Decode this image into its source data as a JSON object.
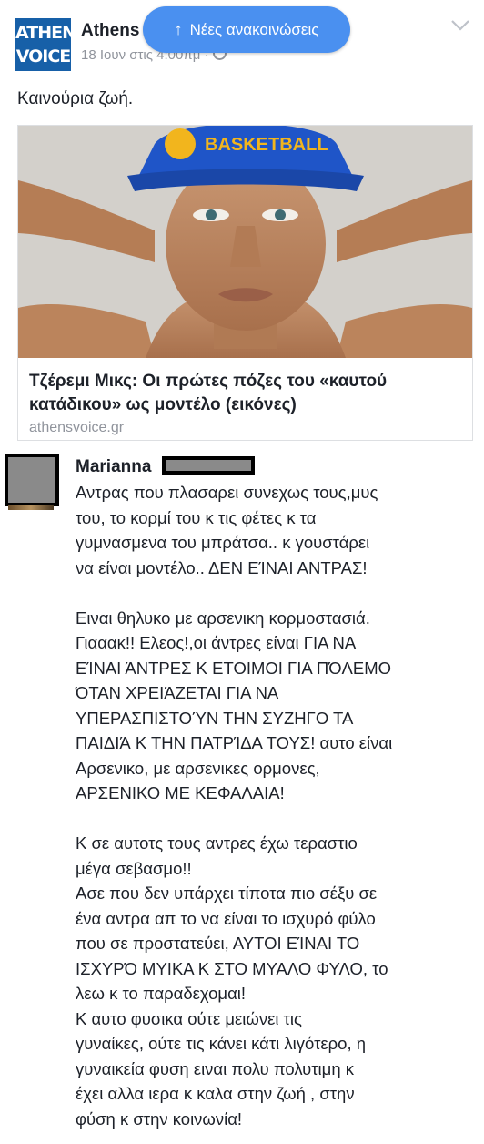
{
  "post": {
    "logo_line1": "ATHENS",
    "logo_line2": "VOICE",
    "page_name": "Athens",
    "meta": "18 Ιουν στις 4:00πμ ·",
    "new_posts_pill": "Νέες ανακοινώσεις",
    "text": "Καινούρια ζωή.",
    "link": {
      "image_cap_text": "BASKETBALL",
      "title_line1": "Τζέρεμι Μικς: Οι πρώτες πόζες του «καυτού",
      "title_line2": "κατάδικου» ως μοντέλο (εικόνες)",
      "domain": "athensvoice.gr"
    }
  },
  "comment": {
    "author": "Marianna",
    "lines": [
      "Αντρας που πλασαρει συνεχως τους,μυς",
      "του, το κορμί του κ τις φέτες κ τα",
      "γυμνασμενα του μπράτσα.. κ γουστάρει",
      "να είναι μοντέλο.. ΔΕΝ ΕΊΝΑΙ ΑΝΤΡΑΣ!",
      "",
      "Ειναι θηλυκο με αρσενικη κορμοστασιά.",
      "Γιααακ!! Ελεος!,οι άντρες είναι ΓΙΑ ΝΑ",
      "ΕΊΝΑΙ ΆΝΤΡΕΣ Κ ΕΤΟΙΜΟΙ ΓΙΑ ΠΌΛΕΜΟ",
      "ΌΤΑΝ ΧΡΕΙΆΖΕΤΑΙ ΓΙΑ ΝΑ",
      "ΥΠΕΡΑΣΠΙΣΤΟΎΝ ΤΗΝ ΣΥΖΗΓΟ ΤΑ",
      "ΠΑΙΔΙΆ Κ ΤΗΝ ΠΑΤΡΊΔΑ ΤΟΥΣ! αυτο είναι",
      "Αρσενικο, με αρσενικες ορμονες,",
      "ΑΡΣΕΝΙΚΟ ΜΕ ΚΕΦΑΛΑΙΑ!",
      "",
      "Κ σε αυτοτς τους αντρες έχω τεραστιο",
      "μέγα σεβασμο!!",
      "Ασε που δεν υπάρχει τίποτα πιο σέξυ σε",
      "ένα αντρα απ το να είναι το ισχυρό φύλο",
      "που σε προστατεύει, ΑΥΤΟΙ ΕΊΝΑΙ ΤΟ",
      "ΙΣΧΥΡΌ ΜΥΙΚΑ Κ ΣΤΟ ΜΥΑΛΟ ΦΥΛΟ, το",
      "λεω κ το παραδεχομαι!",
      "Κ αυτο φυσικα ούτε μειώνει τις",
      "γυναίκες, ούτε τις κάνει κάτι λιγότερο, η",
      "γυναικεία φυση ειναι πολυ πολυτιμη κ",
      "έχει αλλα ιερα κ καλα στην ζωή , στην",
      "φύση κ στην κοινωνία!"
    ]
  },
  "colors": {
    "pill_bg": "#4a90f0",
    "logo_bg": "#1760a8",
    "cap_blue": "#1f55c8",
    "cap_yellow": "#f2b51d",
    "text_secondary": "#90949c"
  }
}
